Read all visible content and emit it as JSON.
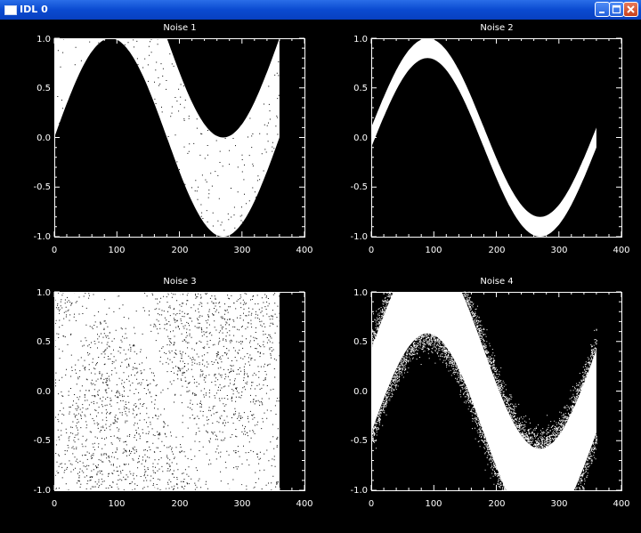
{
  "window": {
    "title": "IDL 0",
    "controls": {
      "minimize": "minimize-icon",
      "maximize": "maximize-icon",
      "close": "close-icon"
    }
  },
  "plots": [
    {
      "title": "Noise 1",
      "x_ticks": [
        "0",
        "100",
        "200",
        "300",
        "400"
      ],
      "y_ticks": [
        "1.0",
        "0.5",
        "0.0",
        "-0.5",
        "-1.0"
      ],
      "xlim": [
        0,
        400
      ],
      "ylim": [
        -1,
        1
      ]
    },
    {
      "title": "Noise 2",
      "x_ticks": [
        "0",
        "100",
        "200",
        "300",
        "400"
      ],
      "y_ticks": [
        "1.0",
        "0.5",
        "0.0",
        "-0.5",
        "-1.0"
      ],
      "xlim": [
        0,
        400
      ],
      "ylim": [
        -1,
        1
      ]
    },
    {
      "title": "Noise 3",
      "x_ticks": [
        "0",
        "100",
        "200",
        "300",
        "400"
      ],
      "y_ticks": [
        "1.0",
        "0.5",
        "0.0",
        "-0.5",
        "-1.0"
      ],
      "xlim": [
        0,
        400
      ],
      "ylim": [
        -1,
        1
      ]
    },
    {
      "title": "Noise 4",
      "x_ticks": [
        "0",
        "100",
        "200",
        "300",
        "400"
      ],
      "y_ticks": [
        "1.0",
        "0.5",
        "0.0",
        "-0.5",
        "-1.0"
      ],
      "xlim": [
        0,
        400
      ],
      "ylim": [
        -1,
        1
      ]
    }
  ],
  "colors": {
    "background": "#000000",
    "foreground": "#ffffff",
    "titlebar": "#0a4ad0"
  }
}
